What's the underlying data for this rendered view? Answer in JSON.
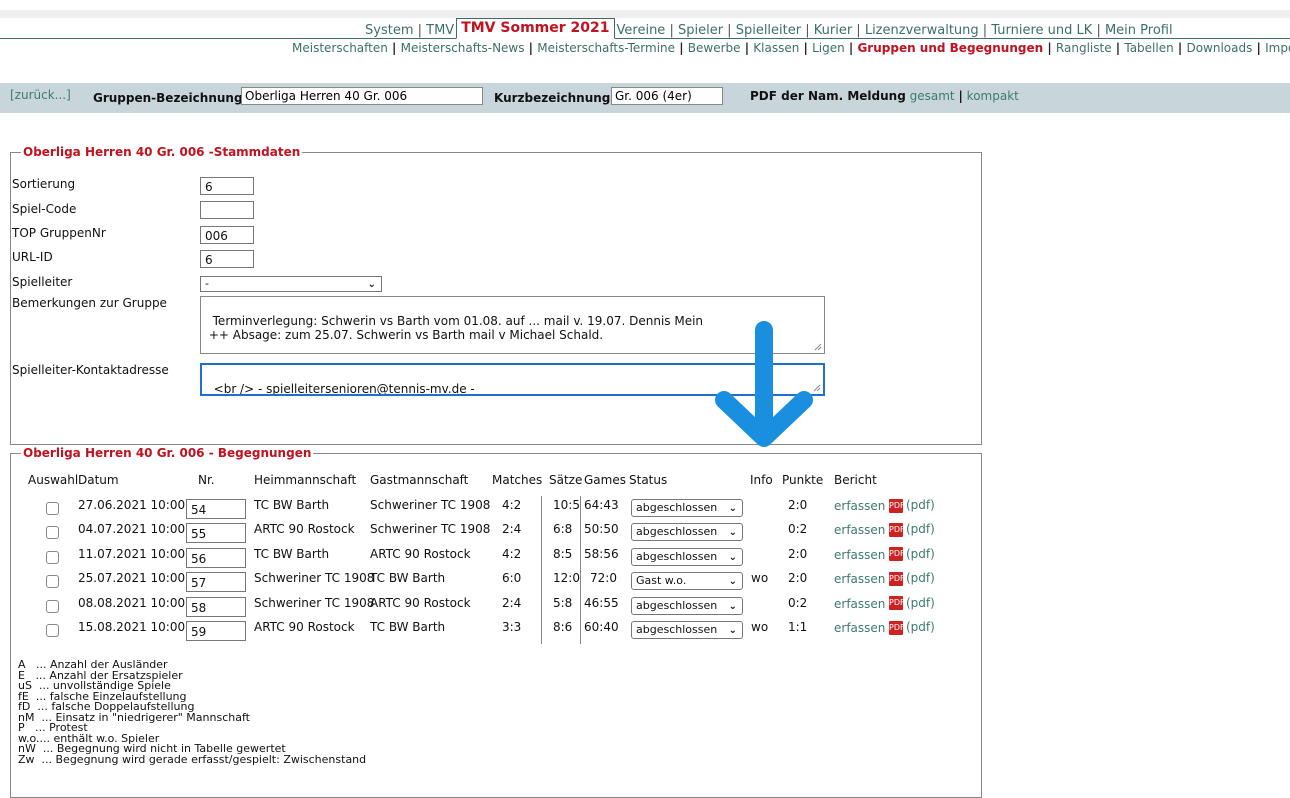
{
  "nav_main": {
    "items": [
      "System",
      "TMV",
      "TMV Sommer 2021",
      "Vereine",
      "Spieler",
      "Spielleiter",
      "Kurier",
      "Lizenzverwaltung",
      "Turniere und LK",
      "Mein Profil"
    ],
    "active": "TMV Sommer 2021"
  },
  "nav_sub": {
    "items": [
      "Meisterschaften",
      "Meisterschafts-News",
      "Meisterschafts-Termine",
      "Bewerbe",
      "Klassen",
      "Ligen",
      "Gruppen und Begegnungen",
      "Rangliste",
      "Tabellen",
      "Downloads",
      "Imports"
    ],
    "active": "Gruppen und Begegnungen"
  },
  "group_bar": {
    "back": "[zurück...]",
    "label_name": "Gruppen-Bezeichnung:",
    "value_name": "Oberliga Herren 40 Gr. 006",
    "label_short": "Kurzbezeichnung:",
    "value_short": "Gr. 006 (4er)",
    "pdf_label": "PDF der Nam. Meldung",
    "pdf_all": "gesamt",
    "pdf_sep": "|",
    "pdf_compact": "kompakt"
  },
  "stamm": {
    "legend": "Oberliga Herren 40 Gr. 006 -Stammdaten",
    "labels": {
      "sort": "Sortierung",
      "code": "Spiel-Code",
      "top": "TOP GruppenNr",
      "url": "URL-ID",
      "leader": "Spielleiter",
      "remarks": "Bemerkungen zur Gruppe",
      "contact": "Spielleiter-Kontaktadresse"
    },
    "values": {
      "sort": "6",
      "code": "",
      "top": "006",
      "url": "6",
      "leader": "-",
      "remarks": "Terminverlegung: Schwerin vs Barth vom 01.08. auf ... mail v. 19.07. Dennis Mein\n ++ Absage: zum 25.07. Schwerin vs Barth mail v Michael Schald.",
      "contact": "<br /> - spielleitersenioren@tennis-mv.de -"
    }
  },
  "beg": {
    "legend": "Oberliga Herren 40 Gr. 006 - Begegnungen",
    "headers": [
      "Auswahl",
      "Datum",
      "Nr.",
      "Heimmannschaft",
      "Gastmannschaft",
      "Matches",
      "Sätze",
      "Games",
      "Status",
      "Info",
      "Punkte",
      "Bericht"
    ],
    "report_link": "erfassen",
    "pdf_link": "(pdf)",
    "rows": [
      {
        "datum": "27.06.2021 10:00",
        "nr": "54",
        "heim": "TC BW Barth",
        "gast": "Schweriner TC 1908",
        "matches": "4:2",
        "saetze": "10:5",
        "games": "64:43",
        "status": "abgeschlossen",
        "info": "",
        "punkte": "2:0"
      },
      {
        "datum": "04.07.2021 10:00",
        "nr": "55",
        "heim": "ARTC 90 Rostock",
        "gast": "Schweriner TC 1908",
        "matches": "2:4",
        "saetze": "6:8",
        "games": "50:50",
        "status": "abgeschlossen",
        "info": "",
        "punkte": "0:2"
      },
      {
        "datum": "11.07.2021 10:00",
        "nr": "56",
        "heim": "TC BW Barth",
        "gast": "ARTC 90 Rostock",
        "matches": "4:2",
        "saetze": "8:5",
        "games": "58:56",
        "status": "abgeschlossen",
        "info": "",
        "punkte": "2:0"
      },
      {
        "datum": "25.07.2021 10:00",
        "nr": "57",
        "heim": "Schweriner TC 1908",
        "gast": "TC BW Barth",
        "matches": "6:0",
        "saetze": "12:0",
        "games": "72:0",
        "status": "Gast w.o.",
        "info": "wo",
        "punkte": "2:0"
      },
      {
        "datum": "08.08.2021 10:00",
        "nr": "58",
        "heim": "Schweriner TC 1908",
        "gast": "ARTC 90 Rostock",
        "matches": "2:4",
        "saetze": "5:8",
        "games": "46:55",
        "status": "abgeschlossen",
        "info": "",
        "punkte": "0:2"
      },
      {
        "datum": "15.08.2021 10:00",
        "nr": "59",
        "heim": "ARTC 90 Rostock",
        "gast": "TC BW Barth",
        "matches": "3:3",
        "saetze": "8:6",
        "games": "60:40",
        "status": "abgeschlossen",
        "info": "wo",
        "punkte": "1:1"
      }
    ],
    "abbrev": [
      "A   ... Anzahl der Ausländer",
      "E   ... Anzahl der Ersatzspieler",
      "uS  ... unvollständige Spiele",
      "fE  ... falsche Einzelaufstellung",
      "fD  ... falsche Doppelaufstellung",
      "nM  ... Einsatz in \"niedrigerer\" Mannschaft",
      "P   ... Protest",
      "w.o.... enthält w.o. Spieler",
      "nW  ... Begegnung wird nicht in Tabelle gewertet",
      "Zw  ... Begegnung wird gerade erfasst/gespielt: Zwischenstand"
    ]
  },
  "colors": {
    "accent_red": "#c0121f",
    "link_green": "#3d7a6b",
    "bar_bg": "#c8d6dc",
    "arrow_blue": "#1a8fe0"
  },
  "icons": {
    "pdf": "pdf-icon",
    "select": "chevron-down-icon",
    "arrow": "arrow-down-icon"
  }
}
